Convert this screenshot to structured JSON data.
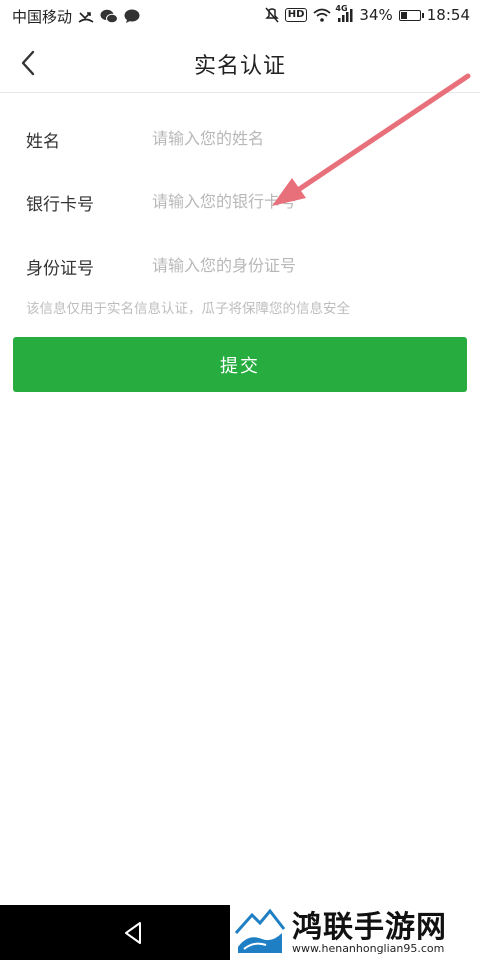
{
  "status_bar": {
    "carrier": "中国移动",
    "battery": "34%",
    "battery_level": 0.34,
    "time": "18:54",
    "hd": "HD",
    "network": "4G"
  },
  "header": {
    "title": "实名认证"
  },
  "form": {
    "fields": [
      {
        "label": "姓名",
        "placeholder": "请输入您的姓名",
        "value": ""
      },
      {
        "label": "银行卡号",
        "placeholder": "请输入您的银行卡号",
        "value": ""
      },
      {
        "label": "身份证号",
        "placeholder": "请输入您的身份证号",
        "value": ""
      }
    ],
    "note": "该信息仅用于实名信息认证，瓜子将保障您的信息安全",
    "submit_label": "提交"
  },
  "watermark": {
    "name": "鸿联手游网",
    "url": "www.henanhonglian95.com"
  },
  "colors": {
    "accent": "#27ad3f",
    "arrow": "#e8707a"
  }
}
